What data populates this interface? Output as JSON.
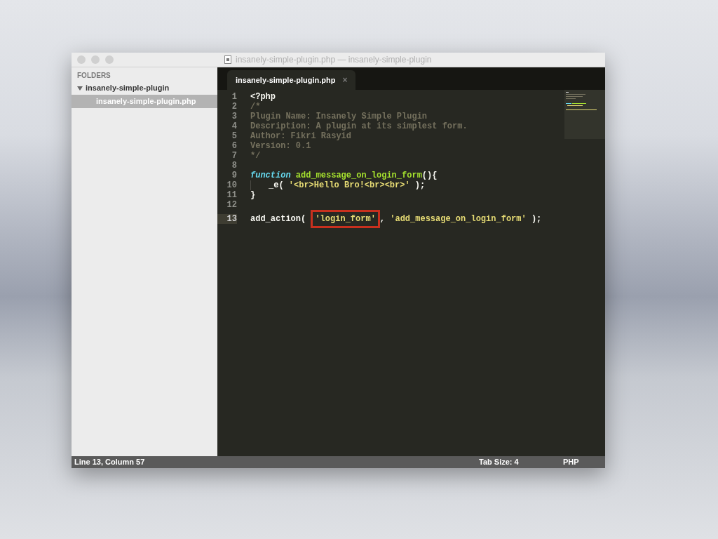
{
  "window": {
    "title": "insanely-simple-plugin.php — insanely-simple-plugin"
  },
  "sidebar": {
    "heading": "FOLDERS",
    "items": [
      {
        "label": "insanely-simple-plugin",
        "expanded": true,
        "children": [
          {
            "label": "insanely-simple-plugin.php",
            "selected": true
          }
        ]
      }
    ]
  },
  "tabs": [
    {
      "label": "insanely-simple-plugin.php",
      "selected": true,
      "close": "×"
    }
  ],
  "editor": {
    "lines": [
      {
        "number": "1",
        "current": false,
        "tokens": [
          {
            "kind": "plain",
            "text": "<?php"
          }
        ]
      },
      {
        "number": "2",
        "current": false,
        "tokens": [
          {
            "kind": "comment",
            "text": "/*"
          }
        ]
      },
      {
        "number": "3",
        "current": false,
        "tokens": [
          {
            "kind": "comment",
            "text": "Plugin Name: Insanely Simple Plugin"
          }
        ]
      },
      {
        "number": "4",
        "current": false,
        "tokens": [
          {
            "kind": "comment",
            "text": "Description: A plugin at its simplest form."
          }
        ]
      },
      {
        "number": "5",
        "current": false,
        "tokens": [
          {
            "kind": "comment",
            "text": "Author: Fikri Rasyid"
          }
        ]
      },
      {
        "number": "6",
        "current": false,
        "tokens": [
          {
            "kind": "comment",
            "text": "Version: 0.1"
          }
        ]
      },
      {
        "number": "7",
        "current": false,
        "tokens": [
          {
            "kind": "comment",
            "text": "*/"
          }
        ]
      },
      {
        "number": "8",
        "current": false
      },
      {
        "number": "9",
        "current": false,
        "tokens": [
          {
            "kind": "keyword",
            "text": "function"
          },
          {
            "kind": "function",
            "text": "add_message_on_login_form"
          },
          {
            "kind": "plain",
            "text": "(){"
          }
        ]
      },
      {
        "number": "10",
        "current": false,
        "indented": true,
        "tokens": [
          {
            "kind": "plain",
            "text": "_e( "
          },
          {
            "kind": "string",
            "text": "'<br>Hello Bro!<br><br>'"
          },
          {
            "kind": "plain",
            "text": " );"
          }
        ]
      },
      {
        "number": "11",
        "current": false,
        "tokens": [
          {
            "kind": "plain",
            "text": "}"
          }
        ]
      },
      {
        "number": "12",
        "current": false
      },
      {
        "number": "13",
        "current": true,
        "tokens": [
          {
            "kind": "plain",
            "text": "add_action( "
          },
          {
            "kind": "string",
            "text": "'login_form'",
            "highlighted": true
          },
          {
            "kind": "plain",
            "text": ", "
          },
          {
            "kind": "string",
            "text": "'add_message_on_login_form'"
          },
          {
            "kind": "plain",
            "text": " );"
          }
        ]
      }
    ]
  },
  "status_bar": {
    "position": "Line 13, Column 57",
    "tab_size": "Tab Size: 4",
    "syntax": "PHP"
  }
}
